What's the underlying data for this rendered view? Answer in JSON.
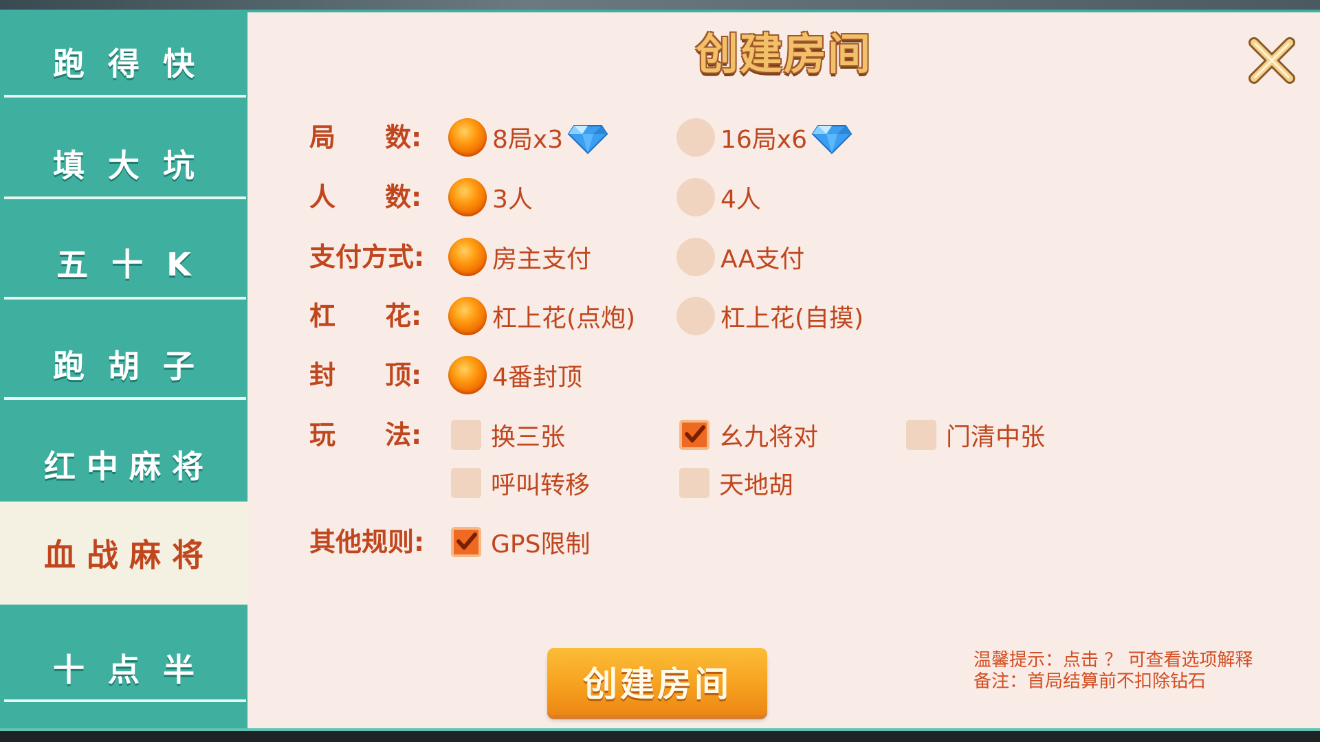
{
  "sidebar": {
    "items": [
      {
        "label": "跑得快",
        "active": false
      },
      {
        "label": "填大坑",
        "active": false
      },
      {
        "label": "五十K",
        "active": false
      },
      {
        "label": "跑胡子",
        "active": false
      },
      {
        "label": "红中麻将",
        "active": false
      },
      {
        "label": "血战麻将",
        "active": true
      },
      {
        "label": "十点半",
        "active": false
      }
    ]
  },
  "panel": {
    "title": "创建房间",
    "close_icon": "close-x-icon",
    "rows": {
      "rounds": {
        "label_a": "局",
        "label_b": "数:",
        "options": [
          {
            "text": "8局x3",
            "selected": true,
            "icon": "diamond-icon"
          },
          {
            "text": "16局x6",
            "selected": false,
            "icon": "diamond-icon"
          }
        ]
      },
      "players": {
        "label_a": "人",
        "label_b": "数:",
        "options": [
          {
            "text": "3人",
            "selected": true
          },
          {
            "text": "4人",
            "selected": false
          }
        ]
      },
      "payment": {
        "label": "支付方式:",
        "options": [
          {
            "text": "房主支付",
            "selected": true
          },
          {
            "text": "AA支付",
            "selected": false
          }
        ]
      },
      "gang_flower": {
        "label_a": "杠",
        "label_b": "花:",
        "options": [
          {
            "text": "杠上花(点炮)",
            "selected": true
          },
          {
            "text": "杠上花(自摸)",
            "selected": false
          }
        ]
      },
      "cap": {
        "label_a": "封",
        "label_b": "顶:",
        "options": [
          {
            "text": "4番封顶",
            "selected": true
          }
        ]
      },
      "play": {
        "label_a": "玩",
        "label_b": "法:",
        "options": [
          {
            "text": "换三张",
            "checked": false
          },
          {
            "text": "幺九将对",
            "checked": true
          },
          {
            "text": "门清中张",
            "checked": false
          },
          {
            "text": "呼叫转移",
            "checked": false
          },
          {
            "text": "天地胡",
            "checked": false
          }
        ]
      },
      "other": {
        "label": "其他规则:",
        "options": [
          {
            "text": "GPS限制",
            "checked": true
          }
        ]
      }
    },
    "create_button": "创建房间",
    "tip_line1": "温馨提示：点击 ？ 可查看选项解释",
    "tip_line2": "备注：首局结算前不扣除钻石"
  },
  "colors": {
    "sidebar_bg": "#3fb0a0",
    "panel_bg": "#f9ece6",
    "label_text": "#c0461e",
    "radio_on": "#f07a00",
    "radio_off": "#f0d4bf",
    "button": "#f7a422"
  }
}
